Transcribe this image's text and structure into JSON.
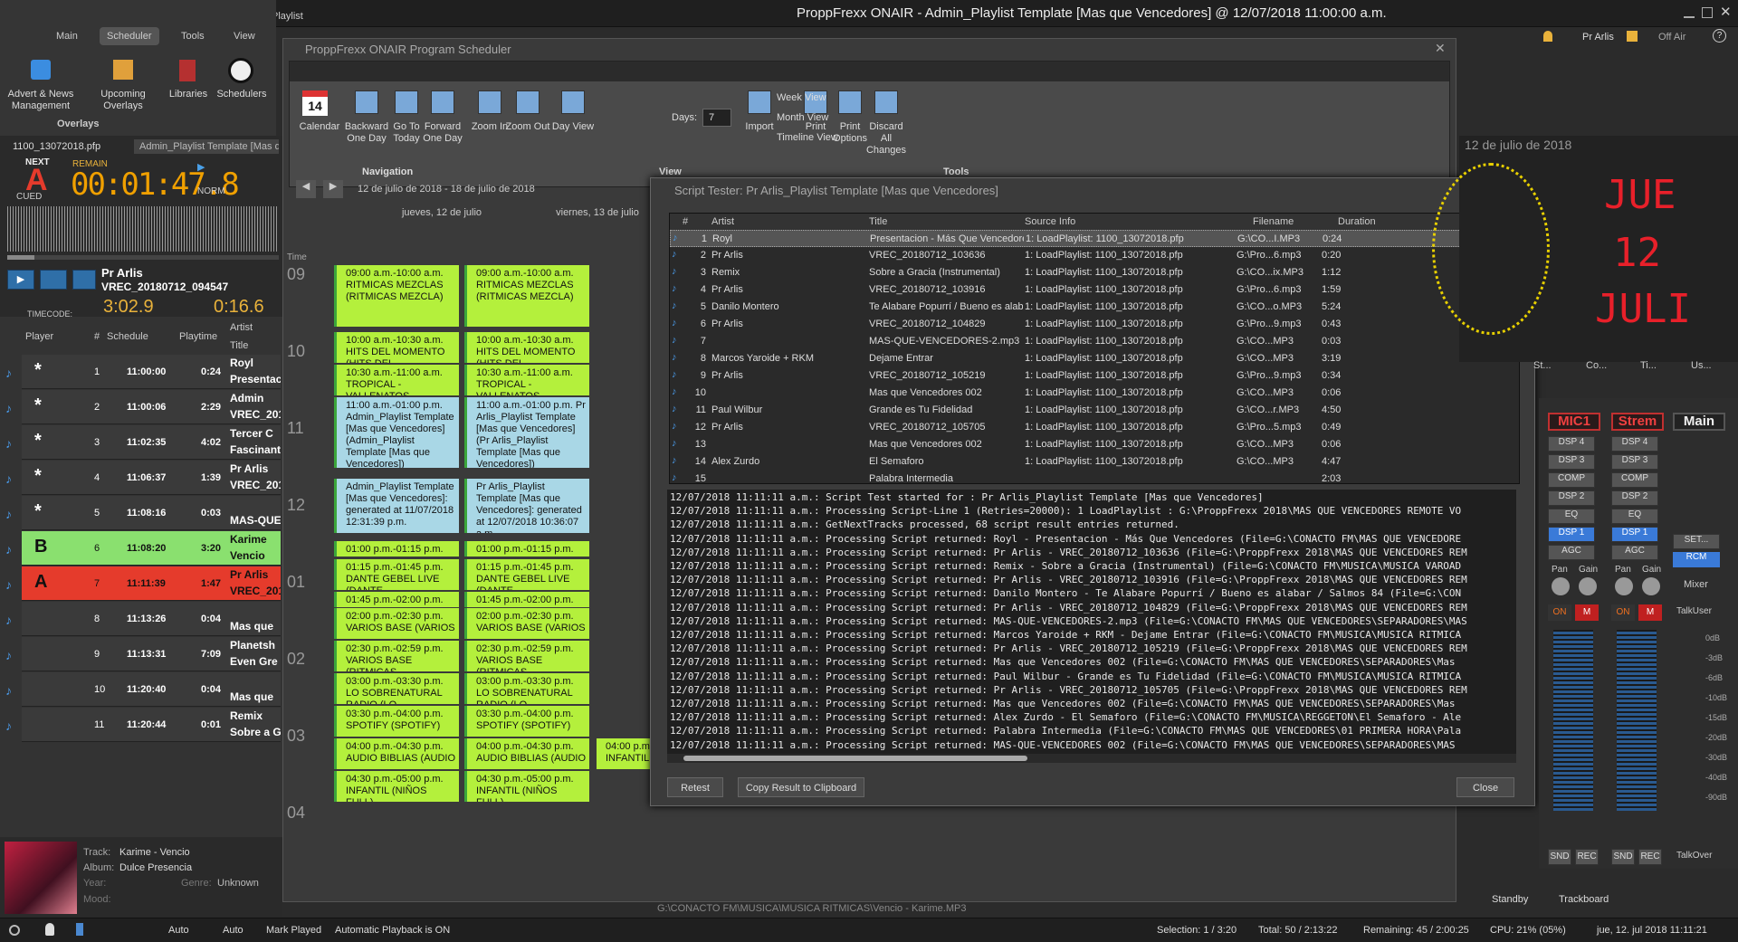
{
  "window": {
    "title": "ProppFrexx ONAIR - Admin_Playlist Template [Mas que Vencedores] @ 12/07/2018 11:00:00 a.m.",
    "user": "Pr Arlis",
    "offair": "Off Air",
    "playlist_label": "Playlist"
  },
  "ribbon": {
    "tabs": [
      "Main",
      "Scheduler",
      "Tools",
      "View"
    ],
    "buttons": [
      "Advert & News Management",
      "Upcoming Overlays",
      "Libraries",
      "Schedulers"
    ],
    "group": "Overlays"
  },
  "player": {
    "tab1": "1100_13072018.pfp",
    "tab2": "Admin_Playlist Template [Mas qu",
    "next": "NEXT",
    "cued": "CUED",
    "remain": "REMAIN",
    "time": "00:01:47.8",
    "norm": "NORM",
    "letter": "A",
    "artist": "Pr Arlis",
    "track": "VREC_20180712_094547",
    "timecode": "TIMECODE:",
    "b_time": "3:02.9",
    "n_time": "0:16.6"
  },
  "playlist": {
    "headers": [
      "Player",
      "#",
      "Schedule",
      "Playtime",
      "Artist",
      "Title"
    ],
    "rows": [
      {
        "mark": "*",
        "num": "1",
        "sched": "11:00:00",
        "play": "0:24",
        "artist": "Royl",
        "title": "Presentac"
      },
      {
        "mark": "*",
        "num": "2",
        "sched": "11:00:06",
        "play": "2:29",
        "artist": "Admin",
        "title": "VREC_201"
      },
      {
        "mark": "*",
        "num": "3",
        "sched": "11:02:35",
        "play": "4:02",
        "artist": "Tercer C",
        "title": "Fascinant"
      },
      {
        "mark": "*",
        "num": "4",
        "sched": "11:06:37",
        "play": "1:39",
        "artist": "Pr Arlis",
        "title": "VREC_201"
      },
      {
        "mark": "*",
        "num": "5",
        "sched": "11:08:16",
        "play": "0:03",
        "artist": "",
        "title": "MAS-QUE"
      },
      {
        "mark": "B",
        "num": "6",
        "sched": "11:08:20",
        "play": "3:20",
        "artist": "Karime",
        "title": "Vencio"
      },
      {
        "mark": "A",
        "num": "7",
        "sched": "11:11:39",
        "play": "1:47",
        "artist": "Pr Arlis",
        "title": "VREC_201"
      },
      {
        "mark": "",
        "num": "8",
        "sched": "11:13:26",
        "play": "0:04",
        "artist": "",
        "title": "Mas que"
      },
      {
        "mark": "",
        "num": "9",
        "sched": "11:13:31",
        "play": "7:09",
        "artist": "Planetsh",
        "title": "Even Gre"
      },
      {
        "mark": "",
        "num": "10",
        "sched": "11:20:40",
        "play": "0:04",
        "artist": "",
        "title": "Mas que"
      },
      {
        "mark": "",
        "num": "11",
        "sched": "11:20:44",
        "play": "0:01",
        "artist": "Remix",
        "title": "Sobre a G"
      }
    ]
  },
  "nowplaying": {
    "track_label": "Track:",
    "track": "Karime - Vencio",
    "album_label": "Album:",
    "album": "Dulce Presencia",
    "year_label": "Year:",
    "genre_label": "Genre:",
    "genre": "Unknown",
    "mood_label": "Mood:"
  },
  "scheduler": {
    "title": "ProppFrexx ONAIR Program Scheduler",
    "buttons": [
      "Calendar",
      "Backward One Day",
      "Go To Today",
      "Forward One Day",
      "Zoom In",
      "Zoom Out",
      "Day View",
      "Import",
      "Print",
      "Print Options",
      "Discard All Changes"
    ],
    "side_buttons": [
      "Week View",
      "Month View",
      "Timeline View"
    ],
    "days_label": "Days:",
    "days_value": "7",
    "groups": [
      "Navigation",
      "View",
      "Tools"
    ],
    "range": "12 de julio de 2018 - 18 de julio de 2018",
    "day1": "jueves, 12 de julio",
    "day2": "viernes, 13 de julio",
    "time_label": "Time",
    "hours": [
      "09",
      "10",
      "11",
      "12",
      "01",
      "02",
      "03",
      "04"
    ],
    "events": [
      {
        "t": "09:00 a.m.-10:00 a.m. RITMICAS MEZCLAS (RITMICAS MEZCLA)"
      },
      {
        "t": "10:00 a.m.-10:30 a.m. HITS DEL MOMENTO (HITS DEL"
      },
      {
        "t": "10:30 a.m.-11:00 a.m. TROPICAL - VALLENATOS -"
      },
      {
        "t": "11:00 a.m.-01:00 p.m. Admin_Playlist Template [Mas que Vencedores] (Admin_Playlist Template [Mas que Vencedores])"
      },
      {
        "t": "Admin_Playlist Template [Mas que Vencedores]: generated at 11/07/2018 12:31:39 p.m."
      },
      {
        "t": "01:00 p.m.-01:15 p.m."
      },
      {
        "t": "01:15 p.m.-01:45 p.m. DANTE GEBEL LIVE (DANTE"
      },
      {
        "t": "01:45 p.m.-02:00 p.m."
      },
      {
        "t": "02:00 p.m.-02:30 p.m. VARIOS BASE (VARIOS"
      },
      {
        "t": "02:30 p.m.-02:59 p.m. VARIOS BASE (RITMICAS"
      },
      {
        "t": "03:00 p.m.-03:30 p.m. LO SOBRENATURAL RADIO (LO"
      },
      {
        "t": "03:30 p.m.-04:00 p.m. SPOTIFY (SPOTIFY)"
      },
      {
        "t": "04:00 p.m.-04:30 p.m. AUDIO BIBLIAS (AUDIO"
      },
      {
        "t": "04:30 p.m.-05:00 p.m. INFANTIL (NIÑOS FULL)"
      },
      {
        "t": "11:00 a.m.-01:00 p.m. Pr Arlis_Playlist Template [Mas que Vencedores] (Pr Arlis_Playlist Template [Mas que Vencedores])"
      },
      {
        "t": "Pr Arlis_Playlist Template [Mas que Vencedores]: generated at 12/07/2018 10:36:07 a.m."
      },
      {
        "t": "04:00 p.m.-05:00 p.m. INFANTIL (NIÑOS FULL)"
      }
    ]
  },
  "tester": {
    "title": "Script Tester: Pr Arlis_Playlist Template [Mas que Vencedores]",
    "headers": [
      "#",
      "Artist",
      "Title",
      "Source Info",
      "Filename",
      "Duration"
    ],
    "rows": [
      {
        "n": "1",
        "a": "Royl",
        "t": "Presentacion - Más Que Vencedores",
        "s": "1: LoadPlaylist: 1100_13072018.pfp",
        "f": "G:\\CO...I.MP3",
        "d": "0:24"
      },
      {
        "n": "2",
        "a": "Pr Arlis",
        "t": "VREC_20180712_103636",
        "s": "1: LoadPlaylist: 1100_13072018.pfp",
        "f": "G:\\Pro...6.mp3",
        "d": "0:20"
      },
      {
        "n": "3",
        "a": "Remix",
        "t": "Sobre a Gracia (Instrumental)",
        "s": "1: LoadPlaylist: 1100_13072018.pfp",
        "f": "G:\\CO...ix.MP3",
        "d": "1:12"
      },
      {
        "n": "4",
        "a": "Pr Arlis",
        "t": "VREC_20180712_103916",
        "s": "1: LoadPlaylist: 1100_13072018.pfp",
        "f": "G:\\Pro...6.mp3",
        "d": "1:59"
      },
      {
        "n": "5",
        "a": "Danilo Montero",
        "t": "Te Alabare Popurrí / Bueno es alabar ...",
        "s": "1: LoadPlaylist: 1100_13072018.pfp",
        "f": "G:\\CO...o.MP3",
        "d": "5:24"
      },
      {
        "n": "6",
        "a": "Pr Arlis",
        "t": "VREC_20180712_104829",
        "s": "1: LoadPlaylist: 1100_13072018.pfp",
        "f": "G:\\Pro...9.mp3",
        "d": "0:43"
      },
      {
        "n": "7",
        "a": "",
        "t": "MAS-QUE-VENCEDORES-2.mp3",
        "s": "1: LoadPlaylist: 1100_13072018.pfp",
        "f": "G:\\CO...MP3",
        "d": "0:03"
      },
      {
        "n": "8",
        "a": "Marcos Yaroide + RKM",
        "t": "Dejame Entrar",
        "s": "1: LoadPlaylist: 1100_13072018.pfp",
        "f": "G:\\CO...MP3",
        "d": "3:19"
      },
      {
        "n": "9",
        "a": "Pr Arlis",
        "t": "VREC_20180712_105219",
        "s": "1: LoadPlaylist: 1100_13072018.pfp",
        "f": "G:\\Pro...9.mp3",
        "d": "0:34"
      },
      {
        "n": "10",
        "a": "",
        "t": "Mas que Vencedores 002",
        "s": "1: LoadPlaylist: 1100_13072018.pfp",
        "f": "G:\\CO...MP3",
        "d": "0:06"
      },
      {
        "n": "11",
        "a": "Paul Wilbur",
        "t": "Grande es Tu Fidelidad",
        "s": "1: LoadPlaylist: 1100_13072018.pfp",
        "f": "G:\\CO...r.MP3",
        "d": "4:50"
      },
      {
        "n": "12",
        "a": "Pr Arlis",
        "t": "VREC_20180712_105705",
        "s": "1: LoadPlaylist: 1100_13072018.pfp",
        "f": "G:\\Pro...5.mp3",
        "d": "0:49"
      },
      {
        "n": "13",
        "a": "",
        "t": "Mas que Vencedores 002",
        "s": "1: LoadPlaylist: 1100_13072018.pfp",
        "f": "G:\\CO...MP3",
        "d": "0:06"
      },
      {
        "n": "14",
        "a": "Alex Zurdo",
        "t": "El Semaforo",
        "s": "1: LoadPlaylist: 1100_13072018.pfp",
        "f": "G:\\CO...MP3",
        "d": "4:47"
      },
      {
        "n": "15",
        "a": "",
        "t": "Palabra Intermedia",
        "s": "",
        "f": "",
        "d": "2:03"
      }
    ],
    "log": [
      "12/07/2018 11:11:11 a.m.: Script Test started for : Pr Arlis_Playlist Template [Mas que Vencedores]",
      "12/07/2018 11:11:11 a.m.: Processing Script-Line 1 (Retries=20000): 1 LoadPlaylist : G:\\ProppFrexx 2018\\MAS QUE VENCEDORES REMOTE VO",
      "12/07/2018 11:11:11 a.m.: GetNextTracks processed, 68 script result entries returned.",
      "12/07/2018 11:11:11 a.m.: Processing Script returned: Royl - Presentacion - Más Que Vencedores (File=G:\\CONACTO FM\\MAS QUE VENCEDORE",
      "12/07/2018 11:11:11 a.m.: Processing Script returned: Pr Arlis - VREC_20180712_103636 (File=G:\\ProppFrexx 2018\\MAS QUE VENCEDORES REM",
      "12/07/2018 11:11:11 a.m.: Processing Script returned: Remix - Sobre a Gracia (Instrumental) (File=G:\\CONACTO FM\\MUSICA\\MUSICA VAROAD",
      "12/07/2018 11:11:11 a.m.: Processing Script returned: Pr Arlis - VREC_20180712_103916 (File=G:\\ProppFrexx 2018\\MAS QUE VENCEDORES REM",
      "12/07/2018 11:11:11 a.m.: Processing Script returned: Danilo Montero - Te Alabare Popurrí / Bueno es alabar / Salmos 84 (File=G:\\CON",
      "12/07/2018 11:11:11 a.m.: Processing Script returned: Pr Arlis - VREC_20180712_104829 (File=G:\\ProppFrexx 2018\\MAS QUE VENCEDORES REM",
      "12/07/2018 11:11:11 a.m.: Processing Script returned: MAS-QUE-VENCEDORES-2.mp3 (File=G:\\CONACTO FM\\MAS QUE VENCEDORES\\SEPARADORES\\MAS",
      "12/07/2018 11:11:11 a.m.: Processing Script returned: Marcos Yaroide + RKM - Dejame Entrar (File=G:\\CONACTO FM\\MUSICA\\MUSICA RITMICA",
      "12/07/2018 11:11:11 a.m.: Processing Script returned: Pr Arlis - VREC_20180712_105219 (File=G:\\ProppFrexx 2018\\MAS QUE VENCEDORES REM",
      "12/07/2018 11:11:11 a.m.: Processing Script returned: Mas que Vencedores 002 (File=G:\\CONACTO FM\\MAS QUE VENCEDORES\\SEPARADORES\\Mas",
      "12/07/2018 11:11:11 a.m.: Processing Script returned: Paul Wilbur - Grande es Tu Fidelidad (File=G:\\CONACTO FM\\MUSICA\\MUSICA RITMICA",
      "12/07/2018 11:11:11 a.m.: Processing Script returned: Pr Arlis - VREC_20180712_105705 (File=G:\\ProppFrexx 2018\\MAS QUE VENCEDORES REM",
      "12/07/2018 11:11:11 a.m.: Processing Script returned: Mas que Vencedores 002 (File=G:\\CONACTO FM\\MAS QUE VENCEDORES\\SEPARADORES\\Mas",
      "12/07/2018 11:11:11 a.m.: Processing Script returned: Alex Zurdo - El Semaforo (File=G:\\CONACTO FM\\MUSICA\\REGGETON\\El Semaforo - Ale",
      "12/07/2018 11:11:11 a.m.: Processing Script returned: Palabra Intermedia (File=G:\\CONACTO FM\\MAS QUE VENCEDORES\\01 PRIMERA HORA\\Pala",
      "12/07/2018 11:11:11 a.m.: Processing Script returned: MAS-QUE-VENCEDORES 002 (File=G:\\CONACTO FM\\MAS QUE VENCEDORES\\SEPARADORES\\MAS"
    ],
    "retest": "Retest",
    "copy": "Copy Result to Clipboard",
    "close": "Close"
  },
  "clock": {
    "date": "12 de julio de 2018",
    "day": "JUE",
    "num": "12",
    "month": "JULI"
  },
  "mixer": {
    "channels": [
      "MIC1",
      "Strem",
      "Main"
    ],
    "dsp": [
      "DSP 4",
      "DSP 3",
      "COMP",
      "DSP 2",
      "EQ",
      "DSP 1",
      "AGC"
    ],
    "pan": "Pan",
    "gain": "Gain",
    "on": "ON",
    "m": "M",
    "snd": "SND",
    "rec": "REC",
    "mixer_label": "Mixer",
    "talkuser": "TalkUser",
    "talkover": "TalkOver",
    "set": "SET...",
    "rcm": "RCM",
    "db": [
      "0dB",
      "-3dB",
      "-6dB",
      "-10dB",
      "-15dB",
      "-20dB",
      "-30dB",
      "-40dB",
      "-90dB"
    ],
    "tabs": [
      "St...",
      "Co...",
      "Ti...",
      "Us..."
    ]
  },
  "status": {
    "auto1": "Auto",
    "auto2": "Auto",
    "mark": "Mark Played",
    "autoplay": "Automatic Playback is ON",
    "selection": "Selection: 1 / 3:20",
    "total": "Total: 50 / 2:13:22",
    "remaining": "Remaining: 45 / 2:00:25",
    "cpu": "CPU: 21% (05%)",
    "datetime": "jue, 12. jul 2018 11:11:21",
    "standby": "Standby",
    "trackboard": "Trackboard",
    "path": "G:\\CONACTO FM\\MUSICA\\MUSICA RITMICAS\\Vencio - Karime.MP3"
  },
  "colors": {
    "accent": "#b4f03c",
    "blue_event": "#a9d7e6",
    "red": "#e53b2c",
    "green": "#8ae06f"
  }
}
